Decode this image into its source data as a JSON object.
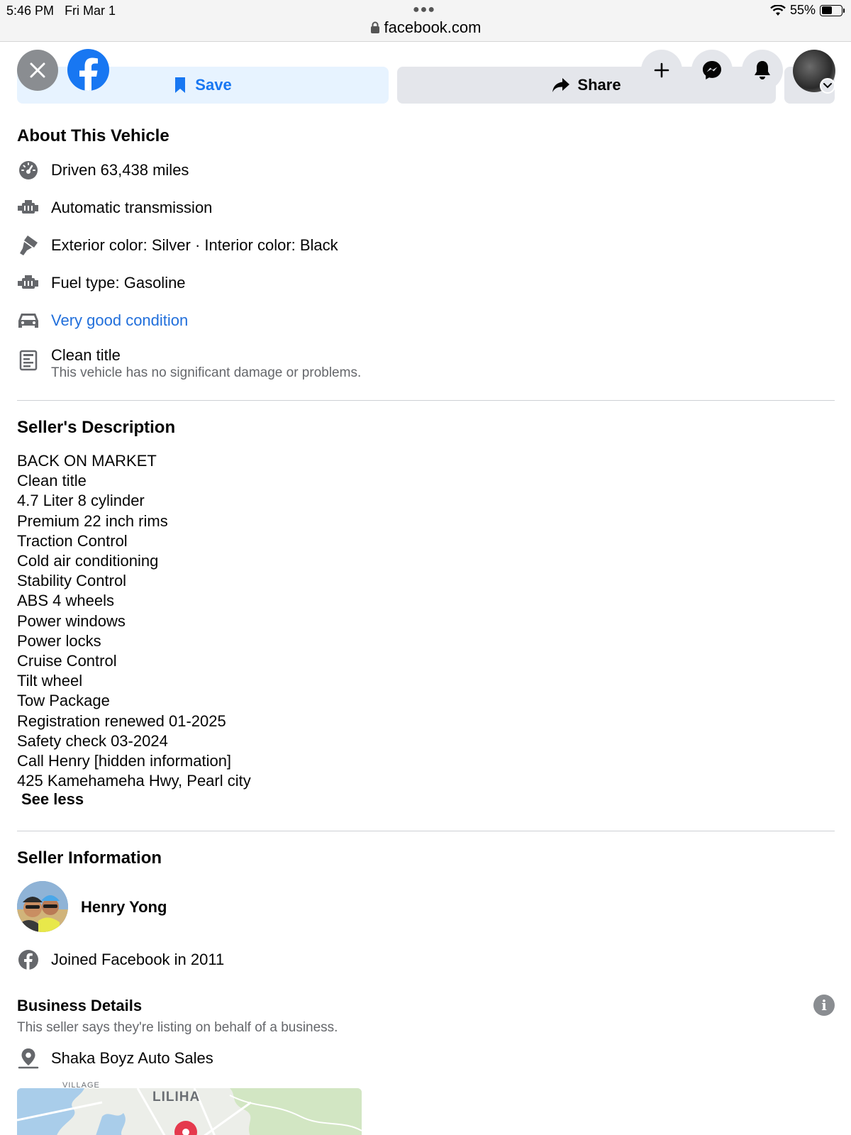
{
  "status_bar": {
    "time": "5:46 PM",
    "date": "Fri Mar 1",
    "battery": "55%",
    "battery_level": 0.55,
    "url": "facebook.com"
  },
  "header": {
    "save_label": "Save",
    "share_label": "Share"
  },
  "about": {
    "title": "About This Vehicle",
    "items": [
      {
        "icon": "speedometer-icon",
        "text": "Driven 63,438 miles"
      },
      {
        "icon": "engine-icon",
        "text": "Automatic transmission"
      },
      {
        "icon": "paint-brush-icon",
        "text": "Exterior color: Silver · Interior color: Black"
      },
      {
        "icon": "engine-icon",
        "text": "Fuel type: Gasoline"
      },
      {
        "icon": "car-icon",
        "text": "Very good condition"
      },
      {
        "icon": "document-icon",
        "text": "Clean title",
        "subtext": "This vehicle has no significant damage or problems."
      }
    ]
  },
  "description": {
    "title": "Seller's Description",
    "lines": [
      "BACK ON MARKET",
      "Clean title",
      "4.7 Liter 8 cylinder",
      "Premium 22 inch rims",
      "Traction Control",
      "Cold air conditioning",
      "Stability Control",
      "ABS 4 wheels",
      "Power windows",
      "Power locks",
      "Cruise Control",
      "Tilt wheel",
      "Tow Package",
      "Registration renewed 01-2025",
      "Safety check 03-2024",
      "Call Henry [hidden information]",
      "425 Kamehameha Hwy,  Pearl city"
    ],
    "see_less": "See less"
  },
  "seller": {
    "title": "Seller Information",
    "name": "Henry Yong",
    "joined": "Joined Facebook in 2011"
  },
  "business": {
    "title": "Business Details",
    "subtitle": "This seller says they're listing on behalf of a business.",
    "name": "Shaka Boyz Auto Sales",
    "map_label": "LILIHA",
    "map_label_small": "VILLAGE"
  },
  "colors": {
    "accent": "#1877f2",
    "link": "#216fdb",
    "secondary_text": "#65676b",
    "button_gray": "#e4e6eb",
    "save_bg": "#e7f3ff"
  }
}
